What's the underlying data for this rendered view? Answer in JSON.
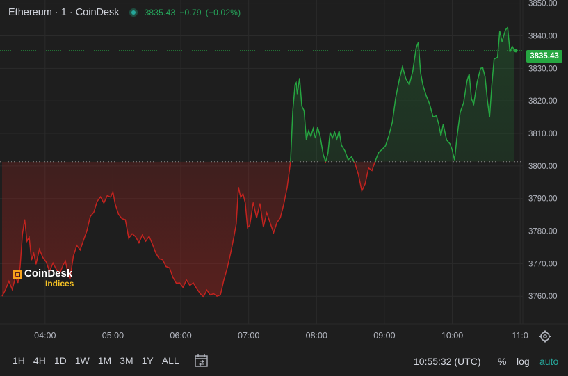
{
  "header": {
    "title": "Ethereum · 1 · CoinDesk",
    "last_price": "3835.43",
    "change": "−0.79",
    "change_pct": "(−0.02%)"
  },
  "price_tag": "3835.43",
  "logo": {
    "name": "CoinDesk",
    "sub": "Indices"
  },
  "chart_data": {
    "type": "line",
    "title": "Ethereum · 1 · CoinDesk",
    "xlabel": "",
    "ylabel": "",
    "x_ticks": [
      "04:00",
      "05:00",
      "06:00",
      "07:00",
      "08:00",
      "09:00",
      "10:00",
      "11:0"
    ],
    "y_ticks": [
      "3760.00",
      "3770.00",
      "3780.00",
      "3790.00",
      "3800.00",
      "3810.00",
      "3820.00",
      "3830.00",
      "3840.00",
      "3850.00"
    ],
    "ylim": [
      3751.5,
      3851
    ],
    "x_range": [
      "03:22",
      "10:55"
    ],
    "baseline": 3801.3,
    "last": 3835.43,
    "colors": {
      "up": "#26a641",
      "down": "#c3231f"
    },
    "grid": true,
    "series": [
      {
        "values": [
          [
            "03:22",
            3760.0
          ],
          [
            "03:25",
            3762.0
          ],
          [
            "03:28",
            3764.6
          ],
          [
            "03:31",
            3762.1
          ],
          [
            "03:34",
            3766.0
          ],
          [
            "03:36",
            3764.1
          ],
          [
            "03:38",
            3769.2
          ],
          [
            "03:40",
            3779.1
          ],
          [
            "03:42",
            3783.6
          ],
          [
            "03:44",
            3776.9
          ],
          [
            "03:46",
            3778.1
          ],
          [
            "03:48",
            3771.1
          ],
          [
            "03:50",
            3773.2
          ],
          [
            "03:52",
            3769.8
          ],
          [
            "03:55",
            3774.4
          ],
          [
            "03:58",
            3771.9
          ],
          [
            "04:01",
            3770.5
          ],
          [
            "04:04",
            3767.6
          ],
          [
            "04:07",
            3770.2
          ],
          [
            "04:10",
            3768.2
          ],
          [
            "04:13",
            3767.0
          ],
          [
            "04:16",
            3769.6
          ],
          [
            "04:18",
            3770.8
          ],
          [
            "04:20",
            3767.3
          ],
          [
            "04:22",
            3765.2
          ],
          [
            "04:25",
            3772.3
          ],
          [
            "04:28",
            3775.6
          ],
          [
            "04:31",
            3774.2
          ],
          [
            "04:34",
            3777.2
          ],
          [
            "04:37",
            3780.1
          ],
          [
            "04:40",
            3784.5
          ],
          [
            "04:43",
            3785.7
          ],
          [
            "04:46",
            3789.1
          ],
          [
            "04:49",
            3790.5
          ],
          [
            "04:52",
            3788.6
          ],
          [
            "04:55",
            3790.9
          ],
          [
            "04:58",
            3790.4
          ],
          [
            "05:00",
            3792.1
          ],
          [
            "05:02",
            3788.3
          ],
          [
            "05:05",
            3785.1
          ],
          [
            "05:08",
            3783.8
          ],
          [
            "05:11",
            3783.5
          ],
          [
            "05:14",
            3777.8
          ],
          [
            "05:17",
            3779.2
          ],
          [
            "05:20",
            3778.3
          ],
          [
            "05:23",
            3776.4
          ],
          [
            "05:26",
            3778.8
          ],
          [
            "05:29",
            3776.9
          ],
          [
            "05:32",
            3778.4
          ],
          [
            "05:35",
            3775.9
          ],
          [
            "05:38",
            3773.2
          ],
          [
            "05:41",
            3771.5
          ],
          [
            "05:44",
            3771.2
          ],
          [
            "05:47",
            3769.1
          ],
          [
            "05:50",
            3768.7
          ],
          [
            "05:53",
            3765.8
          ],
          [
            "05:56",
            3764.0
          ],
          [
            "05:59",
            3764.1
          ],
          [
            "06:02",
            3762.7
          ],
          [
            "06:05",
            3765.0
          ],
          [
            "06:08",
            3763.3
          ],
          [
            "06:11",
            3764.1
          ],
          [
            "06:14",
            3762.4
          ],
          [
            "06:17",
            3760.9
          ],
          [
            "06:20",
            3759.8
          ],
          [
            "06:23",
            3761.9
          ],
          [
            "06:26",
            3760.4
          ],
          [
            "06:29",
            3760.8
          ],
          [
            "06:32",
            3760.0
          ],
          [
            "06:35",
            3760.4
          ],
          [
            "06:38",
            3764.9
          ],
          [
            "06:41",
            3768.6
          ],
          [
            "06:44",
            3773.1
          ],
          [
            "06:47",
            3778.3
          ],
          [
            "06:49",
            3782.2
          ],
          [
            "06:51",
            3793.5
          ],
          [
            "06:53",
            3790.3
          ],
          [
            "06:55",
            3791.5
          ],
          [
            "06:57",
            3788.6
          ],
          [
            "06:59",
            3781.1
          ],
          [
            "07:01",
            3781.8
          ],
          [
            "07:04",
            3788.8
          ],
          [
            "07:07",
            3784.0
          ],
          [
            "07:10",
            3788.5
          ],
          [
            "07:13",
            3781.2
          ],
          [
            "07:16",
            3785.6
          ],
          [
            "07:19",
            3782.5
          ],
          [
            "07:22",
            3779.5
          ],
          [
            "07:25",
            3782.6
          ],
          [
            "07:28",
            3784.1
          ],
          [
            "07:31",
            3788.2
          ],
          [
            "07:34",
            3793.4
          ],
          [
            "07:37",
            3801.3
          ],
          [
            "07:39",
            3816.9
          ],
          [
            "07:41",
            3825.0
          ],
          [
            "07:42",
            3825.6
          ],
          [
            "07:43",
            3822.1
          ],
          [
            "07:45",
            3827.0
          ],
          [
            "07:47",
            3818.4
          ],
          [
            "07:49",
            3817.0
          ],
          [
            "07:51",
            3808.1
          ],
          [
            "07:53",
            3810.8
          ],
          [
            "07:55",
            3809.1
          ],
          [
            "07:57",
            3811.5
          ],
          [
            "07:59",
            3808.5
          ],
          [
            "08:01",
            3811.9
          ],
          [
            "08:03",
            3809.4
          ],
          [
            "08:06",
            3803.5
          ],
          [
            "08:08",
            3801.3
          ],
          [
            "08:10",
            3803.8
          ],
          [
            "08:12",
            3810.3
          ],
          [
            "08:14",
            3808.6
          ],
          [
            "08:16",
            3810.4
          ],
          [
            "08:18",
            3808.3
          ],
          [
            "08:20",
            3810.8
          ],
          [
            "08:22",
            3806.4
          ],
          [
            "08:25",
            3804.7
          ],
          [
            "08:28",
            3801.9
          ],
          [
            "08:31",
            3802.8
          ],
          [
            "08:34",
            3800.8
          ],
          [
            "08:37",
            3797.4
          ],
          [
            "08:40",
            3792.3
          ],
          [
            "08:43",
            3794.5
          ],
          [
            "08:46",
            3799.4
          ],
          [
            "08:49",
            3798.6
          ],
          [
            "08:52",
            3801.6
          ],
          [
            "08:55",
            3804.2
          ],
          [
            "08:58",
            3805.1
          ],
          [
            "09:01",
            3806.2
          ],
          [
            "09:04",
            3809.4
          ],
          [
            "09:07",
            3813.4
          ],
          [
            "09:10",
            3821.0
          ],
          [
            "09:13",
            3826.3
          ],
          [
            "09:16",
            3830.5
          ],
          [
            "09:19",
            3826.8
          ],
          [
            "09:22",
            3825.0
          ],
          [
            "09:25",
            3829.0
          ],
          [
            "09:28",
            3836.2
          ],
          [
            "09:30",
            3838.0
          ],
          [
            "09:32",
            3828.6
          ],
          [
            "09:34",
            3824.9
          ],
          [
            "09:37",
            3821.6
          ],
          [
            "09:40",
            3819.0
          ],
          [
            "09:43",
            3815.1
          ],
          [
            "09:46",
            3815.4
          ],
          [
            "09:48",
            3812.9
          ],
          [
            "09:50",
            3809.3
          ],
          [
            "09:52",
            3812.8
          ],
          [
            "09:55",
            3808.0
          ],
          [
            "09:58",
            3806.8
          ],
          [
            "10:00",
            3804.9
          ],
          [
            "10:02",
            3801.8
          ],
          [
            "10:04",
            3808.4
          ],
          [
            "10:07",
            3816.5
          ],
          [
            "10:10",
            3819.4
          ],
          [
            "10:13",
            3826.1
          ],
          [
            "10:15",
            3828.3
          ],
          [
            "10:17",
            3820.6
          ],
          [
            "10:19",
            3819.0
          ],
          [
            "10:22",
            3825.8
          ],
          [
            "10:25",
            3830.0
          ],
          [
            "10:27",
            3830.2
          ],
          [
            "10:29",
            3827.4
          ],
          [
            "10:31",
            3820.3
          ],
          [
            "10:33",
            3815.0
          ],
          [
            "10:35",
            3825.1
          ],
          [
            "10:37",
            3832.9
          ],
          [
            "10:40",
            3833.4
          ],
          [
            "10:42",
            3841.5
          ],
          [
            "10:44",
            3838.2
          ],
          [
            "10:47",
            3841.8
          ],
          [
            "10:49",
            3842.6
          ],
          [
            "10:51",
            3835.0
          ],
          [
            "10:53",
            3836.8
          ],
          [
            "10:55",
            3835.43
          ]
        ]
      }
    ]
  },
  "ranges": [
    "1H",
    "4H",
    "1D",
    "1W",
    "1M",
    "3M",
    "1Y",
    "ALL"
  ],
  "clock": "10:55:32 (UTC)",
  "options": {
    "percent": "%",
    "log": "log",
    "auto": "auto"
  },
  "icons": {
    "calendar": "calendar-range-icon",
    "settings": "gear-icon"
  }
}
